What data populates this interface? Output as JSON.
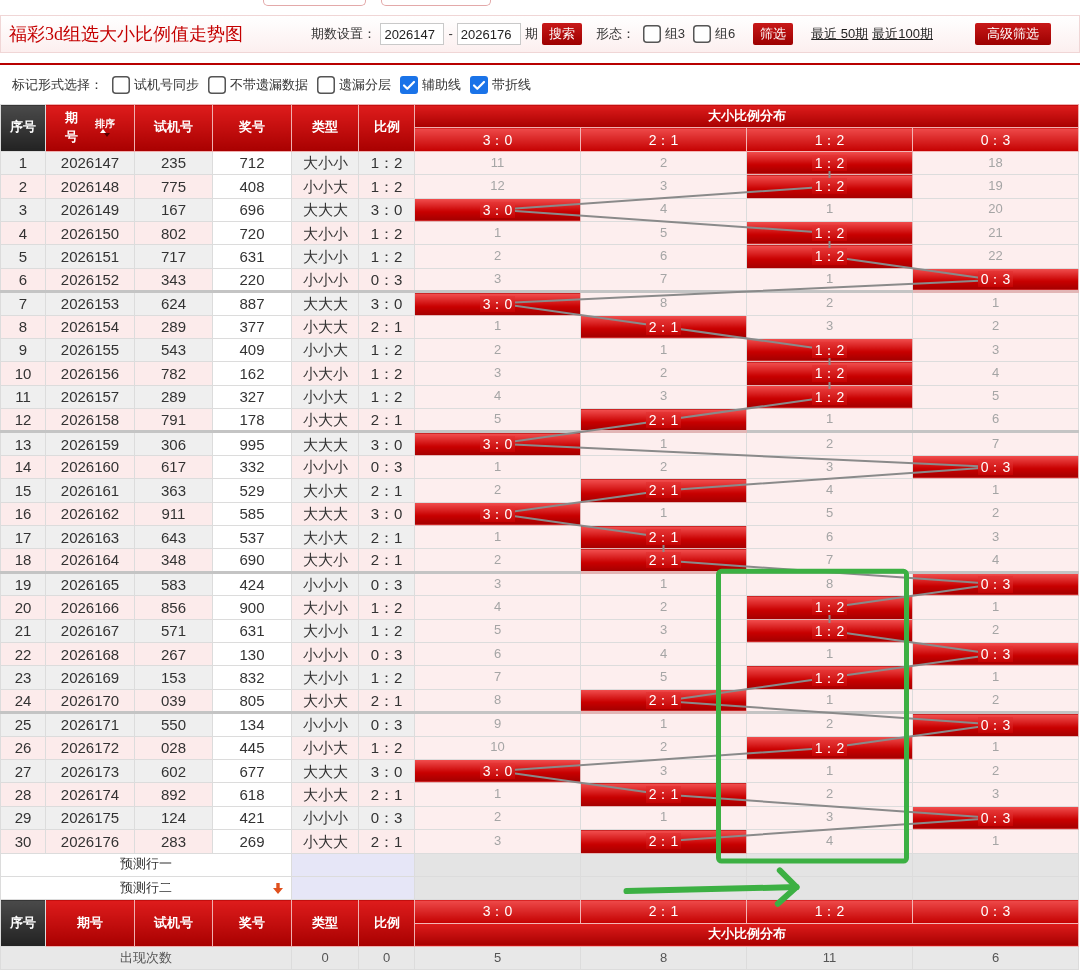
{
  "page": {
    "title": "福彩3d组选大小比例值走势图"
  },
  "filter": {
    "label": "期数设置：",
    "from": "2026147",
    "dash": "-",
    "to": "2026176",
    "unit": "期",
    "search_button": "搜索",
    "form_label": "形态：",
    "forms": [
      {
        "label": "组3",
        "checked": false
      },
      {
        "label": "组6",
        "checked": false
      }
    ],
    "filter_button": "筛选",
    "links": [
      "最近 50期",
      "最近100期"
    ],
    "advanced_button": "高级筛选"
  },
  "options": {
    "label": "标记形式选择：",
    "items": [
      {
        "label": "试机号同步",
        "checked": false
      },
      {
        "label": "不带遗漏数据",
        "checked": false
      },
      {
        "label": "遗漏分层",
        "checked": false
      },
      {
        "label": "辅助线",
        "checked": true
      },
      {
        "label": "带折线",
        "checked": true
      }
    ]
  },
  "table": {
    "columns": [
      "序号",
      "期号",
      "试机号",
      "奖号",
      "类型",
      "比例"
    ],
    "sort_label": "排序",
    "group_title": "大小比例分布",
    "ratios": [
      "3：0",
      "2：1",
      "1：2",
      "0：3"
    ],
    "rows": [
      {
        "no": "1",
        "issue": "2026147",
        "test": "235",
        "draw": "712",
        "type": "大小小",
        "ratio": "1：2",
        "cells": [
          {
            "text": "11",
            "hit": false
          },
          {
            "text": "2",
            "hit": false
          },
          {
            "text": "1：2",
            "hit": true
          },
          {
            "text": "18",
            "hit": false
          }
        ]
      },
      {
        "no": "2",
        "issue": "2026148",
        "test": "775",
        "draw": "408",
        "type": "小小大",
        "ratio": "1：2",
        "cells": [
          {
            "text": "12",
            "hit": false
          },
          {
            "text": "3",
            "hit": false
          },
          {
            "text": "1：2",
            "hit": true
          },
          {
            "text": "19",
            "hit": false
          }
        ]
      },
      {
        "no": "3",
        "issue": "2026149",
        "test": "167",
        "draw": "696",
        "type": "大大大",
        "ratio": "3：0",
        "cells": [
          {
            "text": "3：0",
            "hit": true
          },
          {
            "text": "4",
            "hit": false
          },
          {
            "text": "1",
            "hit": false
          },
          {
            "text": "20",
            "hit": false
          }
        ]
      },
      {
        "no": "4",
        "issue": "2026150",
        "test": "802",
        "draw": "720",
        "type": "大小小",
        "ratio": "1：2",
        "cells": [
          {
            "text": "1",
            "hit": false
          },
          {
            "text": "5",
            "hit": false
          },
          {
            "text": "1：2",
            "hit": true
          },
          {
            "text": "21",
            "hit": false
          }
        ]
      },
      {
        "no": "5",
        "issue": "2026151",
        "test": "717",
        "draw": "631",
        "type": "大小小",
        "ratio": "1：2",
        "cells": [
          {
            "text": "2",
            "hit": false
          },
          {
            "text": "6",
            "hit": false
          },
          {
            "text": "1：2",
            "hit": true
          },
          {
            "text": "22",
            "hit": false
          }
        ]
      },
      {
        "no": "6",
        "issue": "2026152",
        "test": "343",
        "draw": "220",
        "type": "小小小",
        "ratio": "0：3",
        "cells": [
          {
            "text": "3",
            "hit": false
          },
          {
            "text": "7",
            "hit": false
          },
          {
            "text": "1",
            "hit": false
          },
          {
            "text": "0：3",
            "hit": true
          }
        ]
      },
      {
        "no": "7",
        "issue": "2026153",
        "test": "624",
        "draw": "887",
        "type": "大大大",
        "ratio": "3：0",
        "cells": [
          {
            "text": "3：0",
            "hit": true
          },
          {
            "text": "8",
            "hit": false
          },
          {
            "text": "2",
            "hit": false
          },
          {
            "text": "1",
            "hit": false
          }
        ]
      },
      {
        "no": "8",
        "issue": "2026154",
        "test": "289",
        "draw": "377",
        "type": "小大大",
        "ratio": "2：1",
        "cells": [
          {
            "text": "1",
            "hit": false
          },
          {
            "text": "2：1",
            "hit": true
          },
          {
            "text": "3",
            "hit": false
          },
          {
            "text": "2",
            "hit": false
          }
        ]
      },
      {
        "no": "9",
        "issue": "2026155",
        "test": "543",
        "draw": "409",
        "type": "小小大",
        "ratio": "1：2",
        "cells": [
          {
            "text": "2",
            "hit": false
          },
          {
            "text": "1",
            "hit": false
          },
          {
            "text": "1：2",
            "hit": true
          },
          {
            "text": "3",
            "hit": false
          }
        ]
      },
      {
        "no": "10",
        "issue": "2026156",
        "test": "782",
        "draw": "162",
        "type": "小大小",
        "ratio": "1：2",
        "cells": [
          {
            "text": "3",
            "hit": false
          },
          {
            "text": "2",
            "hit": false
          },
          {
            "text": "1：2",
            "hit": true
          },
          {
            "text": "4",
            "hit": false
          }
        ]
      },
      {
        "no": "11",
        "issue": "2026157",
        "test": "289",
        "draw": "327",
        "type": "小小大",
        "ratio": "1：2",
        "cells": [
          {
            "text": "4",
            "hit": false
          },
          {
            "text": "3",
            "hit": false
          },
          {
            "text": "1：2",
            "hit": true
          },
          {
            "text": "5",
            "hit": false
          }
        ]
      },
      {
        "no": "12",
        "issue": "2026158",
        "test": "791",
        "draw": "178",
        "type": "小大大",
        "ratio": "2：1",
        "cells": [
          {
            "text": "5",
            "hit": false
          },
          {
            "text": "2：1",
            "hit": true
          },
          {
            "text": "1",
            "hit": false
          },
          {
            "text": "6",
            "hit": false
          }
        ]
      },
      {
        "no": "13",
        "issue": "2026159",
        "test": "306",
        "draw": "995",
        "type": "大大大",
        "ratio": "3：0",
        "cells": [
          {
            "text": "3：0",
            "hit": true
          },
          {
            "text": "1",
            "hit": false
          },
          {
            "text": "2",
            "hit": false
          },
          {
            "text": "7",
            "hit": false
          }
        ]
      },
      {
        "no": "14",
        "issue": "2026160",
        "test": "617",
        "draw": "332",
        "type": "小小小",
        "ratio": "0：3",
        "cells": [
          {
            "text": "1",
            "hit": false
          },
          {
            "text": "2",
            "hit": false
          },
          {
            "text": "3",
            "hit": false
          },
          {
            "text": "0：3",
            "hit": true
          }
        ]
      },
      {
        "no": "15",
        "issue": "2026161",
        "test": "363",
        "draw": "529",
        "type": "大小大",
        "ratio": "2：1",
        "cells": [
          {
            "text": "2",
            "hit": false
          },
          {
            "text": "2：1",
            "hit": true
          },
          {
            "text": "4",
            "hit": false
          },
          {
            "text": "1",
            "hit": false
          }
        ]
      },
      {
        "no": "16",
        "issue": "2026162",
        "test": "911",
        "draw": "585",
        "type": "大大大",
        "ratio": "3：0",
        "cells": [
          {
            "text": "3：0",
            "hit": true
          },
          {
            "text": "1",
            "hit": false
          },
          {
            "text": "5",
            "hit": false
          },
          {
            "text": "2",
            "hit": false
          }
        ]
      },
      {
        "no": "17",
        "issue": "2026163",
        "test": "643",
        "draw": "537",
        "type": "大小大",
        "ratio": "2：1",
        "cells": [
          {
            "text": "1",
            "hit": false
          },
          {
            "text": "2：1",
            "hit": true
          },
          {
            "text": "6",
            "hit": false
          },
          {
            "text": "3",
            "hit": false
          }
        ]
      },
      {
        "no": "18",
        "issue": "2026164",
        "test": "348",
        "draw": "690",
        "type": "大大小",
        "ratio": "2：1",
        "cells": [
          {
            "text": "2",
            "hit": false
          },
          {
            "text": "2：1",
            "hit": true
          },
          {
            "text": "7",
            "hit": false
          },
          {
            "text": "4",
            "hit": false
          }
        ]
      },
      {
        "no": "19",
        "issue": "2026165",
        "test": "583",
        "draw": "424",
        "type": "小小小",
        "ratio": "0：3",
        "cells": [
          {
            "text": "3",
            "hit": false
          },
          {
            "text": "1",
            "hit": false
          },
          {
            "text": "8",
            "hit": false
          },
          {
            "text": "0：3",
            "hit": true
          }
        ]
      },
      {
        "no": "20",
        "issue": "2026166",
        "test": "856",
        "draw": "900",
        "type": "大小小",
        "ratio": "1：2",
        "cells": [
          {
            "text": "4",
            "hit": false
          },
          {
            "text": "2",
            "hit": false
          },
          {
            "text": "1：2",
            "hit": true
          },
          {
            "text": "1",
            "hit": false
          }
        ]
      },
      {
        "no": "21",
        "issue": "2026167",
        "test": "571",
        "draw": "631",
        "type": "大小小",
        "ratio": "1：2",
        "cells": [
          {
            "text": "5",
            "hit": false
          },
          {
            "text": "3",
            "hit": false
          },
          {
            "text": "1：2",
            "hit": true
          },
          {
            "text": "2",
            "hit": false
          }
        ]
      },
      {
        "no": "22",
        "issue": "2026168",
        "test": "267",
        "draw": "130",
        "type": "小小小",
        "ratio": "0：3",
        "cells": [
          {
            "text": "6",
            "hit": false
          },
          {
            "text": "4",
            "hit": false
          },
          {
            "text": "1",
            "hit": false
          },
          {
            "text": "0：3",
            "hit": true
          }
        ]
      },
      {
        "no": "23",
        "issue": "2026169",
        "test": "153",
        "draw": "832",
        "type": "大小小",
        "ratio": "1：2",
        "cells": [
          {
            "text": "7",
            "hit": false
          },
          {
            "text": "5",
            "hit": false
          },
          {
            "text": "1：2",
            "hit": true
          },
          {
            "text": "1",
            "hit": false
          }
        ]
      },
      {
        "no": "24",
        "issue": "2026170",
        "test": "039",
        "draw": "805",
        "type": "大小大",
        "ratio": "2：1",
        "cells": [
          {
            "text": "8",
            "hit": false
          },
          {
            "text": "2：1",
            "hit": true
          },
          {
            "text": "1",
            "hit": false
          },
          {
            "text": "2",
            "hit": false
          }
        ]
      },
      {
        "no": "25",
        "issue": "2026171",
        "test": "550",
        "draw": "134",
        "type": "小小小",
        "ratio": "0：3",
        "cells": [
          {
            "text": "9",
            "hit": false
          },
          {
            "text": "1",
            "hit": false
          },
          {
            "text": "2",
            "hit": false
          },
          {
            "text": "0：3",
            "hit": true
          }
        ]
      },
      {
        "no": "26",
        "issue": "2026172",
        "test": "028",
        "draw": "445",
        "type": "小小大",
        "ratio": "1：2",
        "cells": [
          {
            "text": "10",
            "hit": false
          },
          {
            "text": "2",
            "hit": false
          },
          {
            "text": "1：2",
            "hit": true
          },
          {
            "text": "1",
            "hit": false
          }
        ]
      },
      {
        "no": "27",
        "issue": "2026173",
        "test": "602",
        "draw": "677",
        "type": "大大大",
        "ratio": "3：0",
        "cells": [
          {
            "text": "3：0",
            "hit": true
          },
          {
            "text": "3",
            "hit": false
          },
          {
            "text": "1",
            "hit": false
          },
          {
            "text": "2",
            "hit": false
          }
        ]
      },
      {
        "no": "28",
        "issue": "2026174",
        "test": "892",
        "draw": "618",
        "type": "大小大",
        "ratio": "2：1",
        "cells": [
          {
            "text": "1",
            "hit": false
          },
          {
            "text": "2：1",
            "hit": true
          },
          {
            "text": "2",
            "hit": false
          },
          {
            "text": "3",
            "hit": false
          }
        ]
      },
      {
        "no": "29",
        "issue": "2026175",
        "test": "124",
        "draw": "421",
        "type": "小小小",
        "ratio": "0：3",
        "cells": [
          {
            "text": "2",
            "hit": false
          },
          {
            "text": "1",
            "hit": false
          },
          {
            "text": "3",
            "hit": false
          },
          {
            "text": "0：3",
            "hit": true
          }
        ]
      },
      {
        "no": "30",
        "issue": "2026176",
        "test": "283",
        "draw": "269",
        "type": "小大大",
        "ratio": "2：1",
        "cells": [
          {
            "text": "3",
            "hit": false
          },
          {
            "text": "2：1",
            "hit": true
          },
          {
            "text": "4",
            "hit": false
          },
          {
            "text": "1",
            "hit": false
          }
        ]
      }
    ],
    "prediction_rows": [
      {
        "label": "预测行一",
        "toggle": false
      },
      {
        "label": "预测行二",
        "toggle": true
      }
    ],
    "footer_columns": [
      "序号",
      "期号",
      "试机号",
      "奖号",
      "类型",
      "比例"
    ],
    "footer_ratios": [
      "3：0",
      "2：1",
      "1：2",
      "0：3"
    ],
    "footer_group_title": "大小比例分布",
    "stats": [
      {
        "label": "出现次数",
        "values": [
          "0",
          "0",
          "5",
          "8",
          "11",
          "6"
        ]
      }
    ]
  },
  "annotations": [
    {
      "kind": "rectangle"
    },
    {
      "kind": "arrow"
    }
  ]
}
